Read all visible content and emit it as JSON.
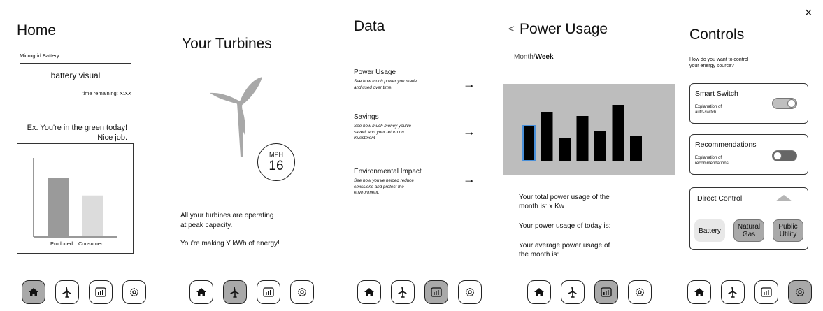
{
  "home": {
    "title": "Home",
    "battery_label": "Microgrid Battery",
    "battery_visual": "battery visual",
    "time_remaining": "time remaining: X:XX",
    "message_line1": "Ex. You're in the green today!",
    "message_line2": "Nice job.",
    "chart_data": {
      "type": "bar",
      "categories": [
        "Produced",
        "Consumed"
      ],
      "values": [
        0.75,
        0.52
      ],
      "colors": [
        "#9a9a9a",
        "#dcdcdc"
      ]
    }
  },
  "turbines": {
    "title": "Your Turbines",
    "speed_unit": "MPH",
    "speed_value": "16",
    "status_line1": "All your turbines are operating",
    "status_line2": "at peak capacity.",
    "energy_text": "You're making Y kWh of energy!"
  },
  "data_screen": {
    "title": "Data",
    "items": [
      {
        "title": "Power Usage",
        "desc": [
          "See how much power you made",
          "and used over time."
        ]
      },
      {
        "title": "Savings",
        "desc": [
          "See how much money you've",
          "saved, and your return on",
          "investment"
        ]
      },
      {
        "title": "Environmental Impact",
        "desc": [
          "See how you've helped reduce",
          "emissions and protect the",
          "environment."
        ]
      }
    ],
    "arrow_glyph": "→"
  },
  "power_usage": {
    "back_glyph": "<",
    "title": "Power Usage",
    "toggle_month": "Month/",
    "toggle_week": "Week",
    "chart_data": {
      "type": "bar",
      "values": [
        0.5,
        0.7,
        0.33,
        0.64,
        0.43,
        0.8,
        0.35
      ],
      "highlight_index": 0,
      "highlight_color": "#4a90d9",
      "background": "#bdbdbd"
    },
    "total_line1": "Your total power usage of the",
    "total_line2": "month is:  x Kw",
    "today": "Your power usage of today is:",
    "avg_line1": "Your average power usage of",
    "avg_line2": "the month is:"
  },
  "controls": {
    "close_glyph": "×",
    "title": "Controls",
    "question_line1": "How do you want to control",
    "question_line2": "your energy source?",
    "smart_switch": {
      "title": "Smart Switch",
      "desc": [
        "Explanation of",
        "auto-switch"
      ],
      "state": "on"
    },
    "recommendations": {
      "title": "Recommendations",
      "desc": [
        "Explanation of",
        "recommendations"
      ],
      "state": "off"
    },
    "direct_control": {
      "title": "Direct Control",
      "options": [
        {
          "line1": "Battery",
          "line2": ""
        },
        {
          "line1": "Natural",
          "line2": "Gas"
        },
        {
          "line1": "Public",
          "line2": "Utility"
        }
      ]
    }
  },
  "nav_items": [
    "home-icon",
    "turbine-icon",
    "chart-icon",
    "gear-icon"
  ]
}
